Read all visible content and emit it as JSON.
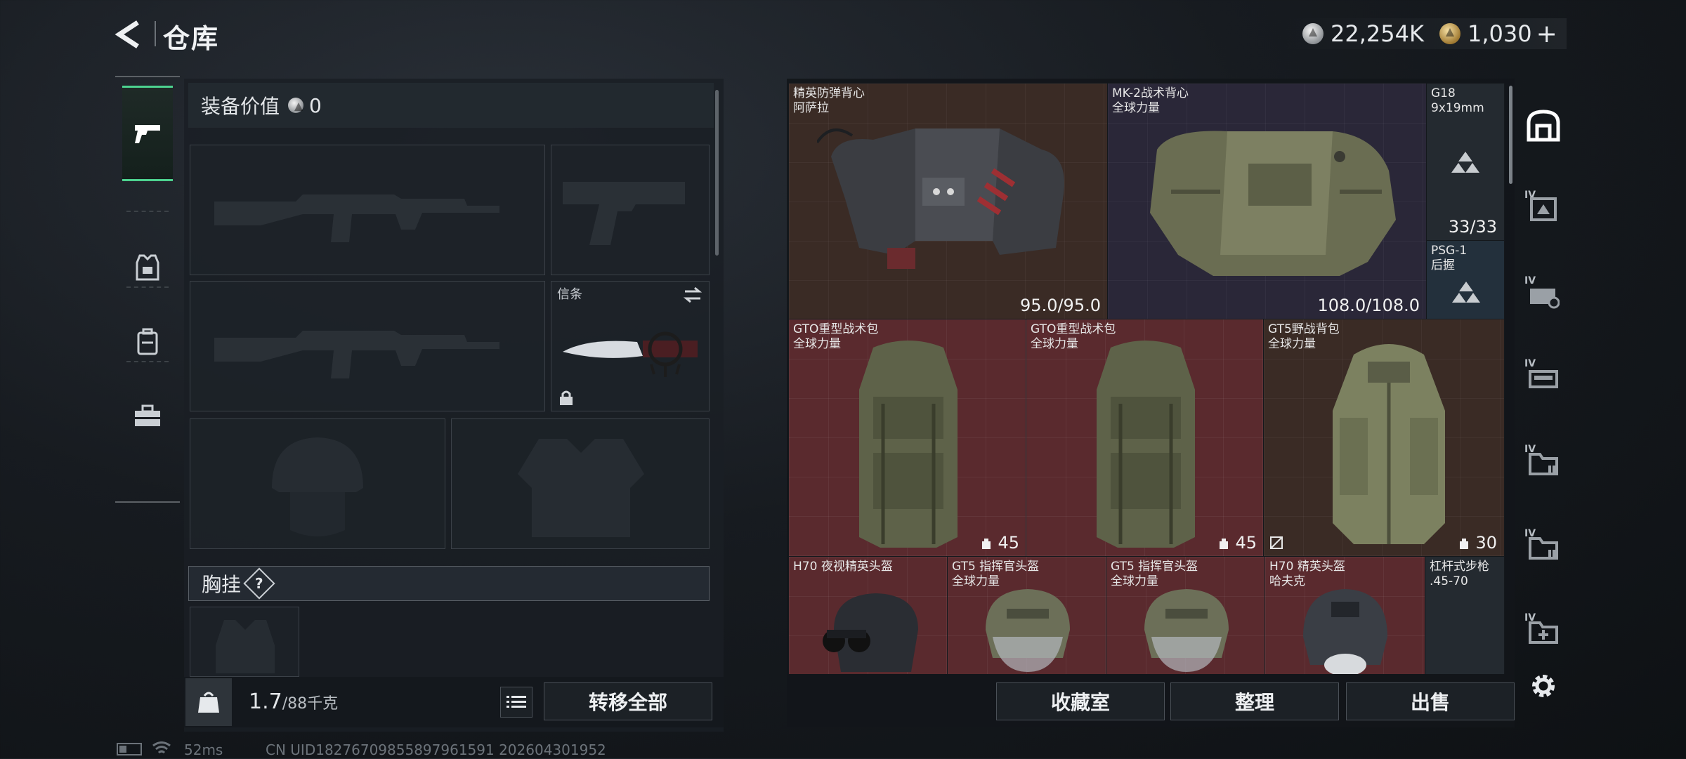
{
  "header": {
    "title": "仓库",
    "currency_silver": "22,254K",
    "currency_gold": "1,030",
    "add_label": "+"
  },
  "left_tabs": [
    {
      "name": "weapons",
      "icon": "pistol-icon",
      "active": true
    },
    {
      "name": "armor",
      "icon": "armor-icon",
      "active": false
    },
    {
      "name": "backpack",
      "icon": "backpack-icon",
      "active": false
    },
    {
      "name": "case",
      "icon": "toolbox-icon",
      "active": false
    }
  ],
  "equipment": {
    "value_label": "装备价值",
    "value": "0",
    "melee_label": "信条",
    "chest_label": "胸挂",
    "help_label": "?",
    "weight_current": "1.7",
    "weight_max": "/88千克",
    "transfer_all": "转移全部"
  },
  "inventory": {
    "items": [
      {
        "name": "精英防弹背心",
        "sub": "阿萨拉",
        "value": "95.0/95.0",
        "rarity": "brown"
      },
      {
        "name": "MK-2战术背心",
        "sub": "全球力量",
        "value": "108.0/108.0",
        "rarity": "purple"
      },
      {
        "name": "G18",
        "sub": "9x19mm",
        "value": "33/33",
        "rarity": "grey"
      },
      {
        "name": "PSG-1",
        "sub": "后握",
        "value": "",
        "rarity": "blue"
      },
      {
        "name": "GTO重型战术包",
        "sub": "全球力量",
        "value": "45",
        "rarity": "red"
      },
      {
        "name": "GTO重型战术包",
        "sub": "全球力量",
        "value": "45",
        "rarity": "red"
      },
      {
        "name": "GT5野战背包",
        "sub": "全球力量",
        "value": "30",
        "rarity": "brown"
      },
      {
        "name": "H70 夜视精英头盔",
        "sub": "",
        "value": "",
        "rarity": "red"
      },
      {
        "name": "GT5 指挥官头盔",
        "sub": "全球力量",
        "value": "",
        "rarity": "red"
      },
      {
        "name": "GT5 指挥官头盔",
        "sub": "全球力量",
        "value": "",
        "rarity": "red"
      },
      {
        "name": "H70 精英头盔",
        "sub": "哈夫克",
        "value": "",
        "rarity": "red"
      },
      {
        "name": "杠杆式步枪",
        "sub": ".45-70",
        "value": "",
        "rarity": "grey"
      }
    ],
    "buttons": {
      "collection": "收藏室",
      "sort": "整理",
      "sell": "出售"
    }
  },
  "right_tabs": [
    {
      "icon": "vault-icon",
      "tier": ""
    },
    {
      "icon": "crate-icon",
      "tier": "IV"
    },
    {
      "icon": "storage-icon",
      "tier": "IV"
    },
    {
      "icon": "weapon-crate-icon",
      "tier": "IV"
    },
    {
      "icon": "folder-icon",
      "tier": "IV"
    },
    {
      "icon": "folder-icon",
      "tier": "IV"
    },
    {
      "icon": "add-storage-icon",
      "tier": "IV"
    }
  ],
  "status": {
    "ping": "52ms",
    "uid": "CN UID18276709855897961591 202604301952"
  },
  "colors": {
    "accent_green": "#4dd28f",
    "rarity_red": "#5a2a2e",
    "rarity_brown": "#3a2b25",
    "rarity_purple": "#2a2738",
    "rarity_blue": "#23303c"
  }
}
